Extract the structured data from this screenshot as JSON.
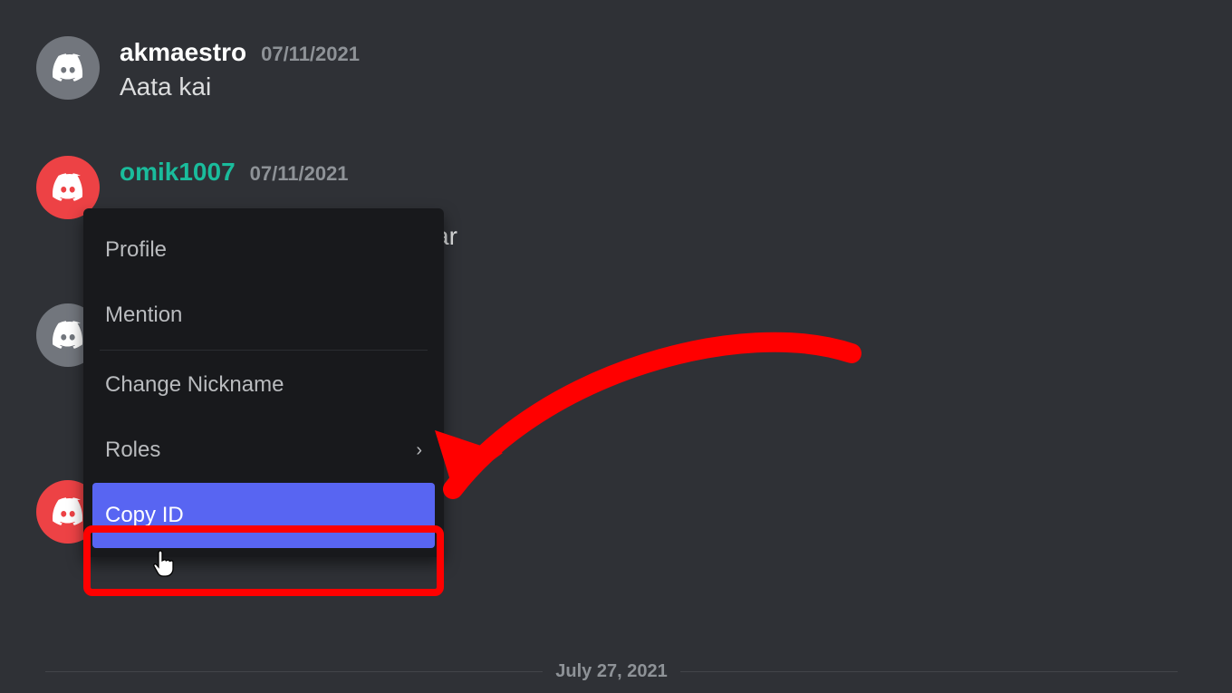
{
  "messages": [
    {
      "username": "akmaestro",
      "username_color": "white",
      "avatar_color": "gray",
      "timestamp": "07/11/2021",
      "text": "Aata kai"
    },
    {
      "username": "omik1007",
      "username_color": "teal",
      "avatar_color": "red",
      "timestamp": "07/11/2021",
      "text_visible_fragment": "ar"
    }
  ],
  "context_menu": {
    "items": [
      {
        "label": "Profile"
      },
      {
        "label": "Mention"
      },
      {
        "divider": true
      },
      {
        "label": "Change Nickname"
      },
      {
        "label": "Roles",
        "has_submenu": true
      },
      {
        "label": "Copy ID",
        "selected": true
      }
    ]
  },
  "date_divider": "July 27, 2021",
  "annotation": {
    "highlight_target": "copy-id-menu-item",
    "arrow_color": "#ff0000",
    "highlight_color": "#ff0000"
  }
}
